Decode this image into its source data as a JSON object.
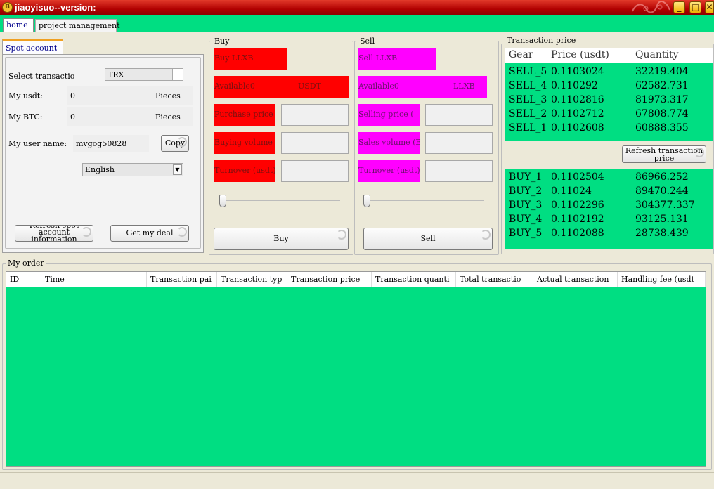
{
  "window": {
    "title": "jiaoyisuo--version:",
    "icon_glyph": "B",
    "minimize_glyph": "_",
    "maximize_glyph": "□",
    "close_glyph": "✕"
  },
  "tabs": [
    {
      "label": "home"
    },
    {
      "label": "project management"
    }
  ],
  "spot": {
    "tab_label": "Spot account",
    "select_label": "Select transactio",
    "select_value": "TRX",
    "usdt_label": "My usdt:",
    "usdt_value": "0",
    "usdt_unit": "Pieces",
    "btc_label": "My BTC:",
    "btc_value": "0",
    "btc_unit": "Pieces",
    "user_label": "My user name:",
    "user_value": "mvgog50828",
    "copy_label": "Copy",
    "language_value": "English",
    "refresh_label": "Refresh spot account information",
    "deal_label": "Get my deal"
  },
  "buy": {
    "group_title": "Buy",
    "pair_label": "Buy        LLXB",
    "available_label": "Available0",
    "available_unit": "USDT",
    "price_label": "Purchase price",
    "volume_label": "Buying volume (",
    "turnover_label": "Turnover (usdt)",
    "slider_value": 0,
    "button_label": "Buy"
  },
  "sell": {
    "group_title": "Sell",
    "pair_label": "Sell       LLXB",
    "available_label": "Available0",
    "available_unit": "LLXB",
    "price_label": "Selling price (",
    "volume_label": "Sales volume (B",
    "turnover_label": "Turnover (usdt)",
    "slider_value": 0,
    "button_label": "Sell"
  },
  "price_panel": {
    "group_title": "Transaction price",
    "headers": [
      "Gear",
      "Price (usdt)",
      "Quantity"
    ],
    "sells": [
      {
        "gear": "SELL_5",
        "price": "0.1103024",
        "qty": "32219.404"
      },
      {
        "gear": "SELL_4",
        "price": "0.110292",
        "qty": "62582.731"
      },
      {
        "gear": "SELL_3",
        "price": "0.1102816",
        "qty": "81973.317"
      },
      {
        "gear": "SELL_2",
        "price": "0.1102712",
        "qty": "67808.774"
      },
      {
        "gear": "SELL_1",
        "price": "0.1102608",
        "qty": "60888.355"
      }
    ],
    "refresh_label": "Refresh transaction price",
    "buys": [
      {
        "gear": "BUY_1",
        "price": "0.1102504",
        "qty": "86966.252"
      },
      {
        "gear": "BUY_2",
        "price": "0.11024",
        "qty": "89470.244"
      },
      {
        "gear": "BUY_3",
        "price": "0.1102296",
        "qty": "304377.337"
      },
      {
        "gear": "BUY_4",
        "price": "0.1102192",
        "qty": "93125.131"
      },
      {
        "gear": "BUY_5",
        "price": "0.1102088",
        "qty": "28738.439"
      }
    ]
  },
  "orders": {
    "group_title": "My order",
    "columns": [
      "ID",
      "Time",
      "Transaction pai",
      "Transaction typ",
      "Transaction price",
      "Transaction quanti",
      "Total transactio",
      "Actual transaction",
      "Handling fee (usdt"
    ]
  },
  "colors": {
    "accent_green": "#00de82",
    "buy_red": "#ff0000",
    "sell_magenta": "#ff00ff",
    "title_red": "#b00000"
  }
}
